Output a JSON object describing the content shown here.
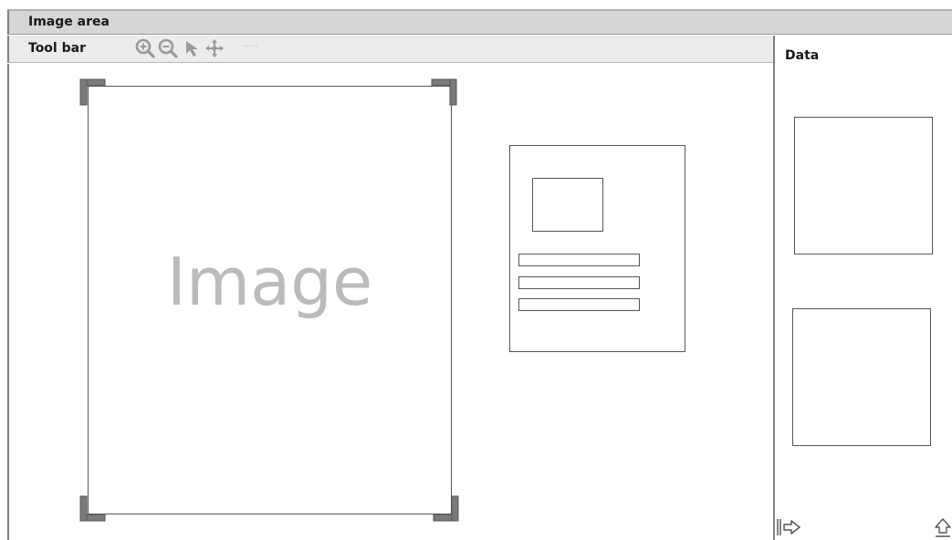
{
  "header": {
    "title": "Image area"
  },
  "toolbar": {
    "title": "Tool bar",
    "tools": [
      {
        "icon": "zoom-in-icon"
      },
      {
        "icon": "zoom-out-icon"
      },
      {
        "icon": "pointer-arrow-icon"
      },
      {
        "icon": "move-icon"
      }
    ],
    "more": "......"
  },
  "canvas": {
    "image_placeholder": "Image"
  },
  "data_panel": {
    "title": "Data"
  },
  "colors": {
    "header_bg": "#d6d6d6",
    "toolbar_bg": "#ececec",
    "icon_gray": "#9a9a9a",
    "handle_gray": "#7a7a7a",
    "placeholder_text": "#bbbbbb"
  }
}
